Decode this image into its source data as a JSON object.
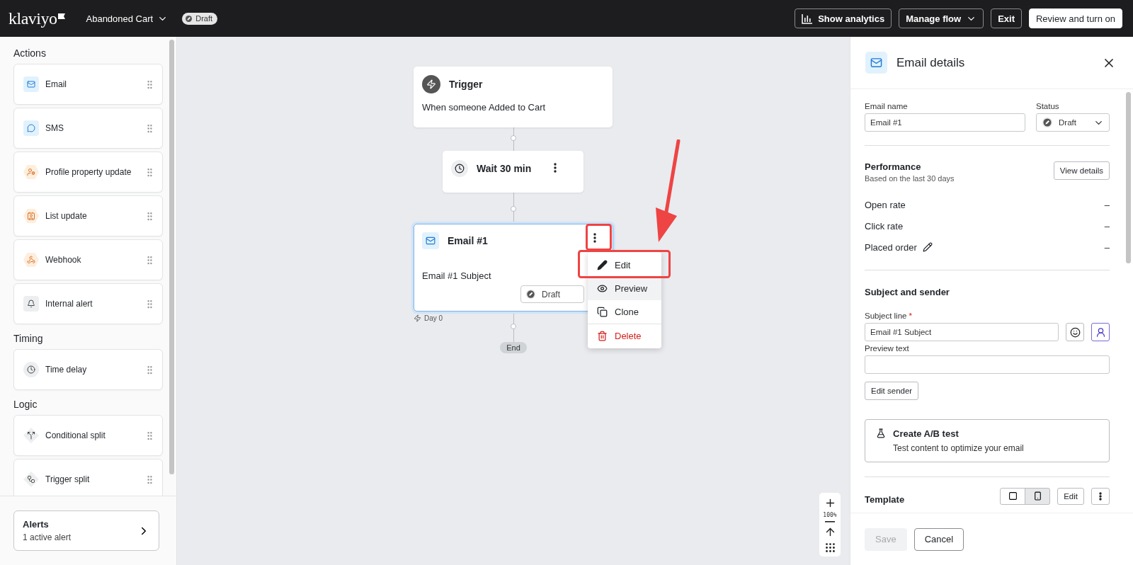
{
  "header": {
    "logo": "klaviyo",
    "flow_name": "Abandoned Cart",
    "status": "Draft",
    "buttons": [
      {
        "label": "Show analytics",
        "kind": "analytics"
      },
      {
        "label": "Manage flow",
        "kind": "dropdown"
      },
      {
        "label": "Exit",
        "kind": "plain"
      },
      {
        "label": "Review and turn on",
        "kind": "primary"
      }
    ]
  },
  "sidebar": {
    "sections": [
      {
        "title": "Actions",
        "items": [
          {
            "label": "Email",
            "kind": "email"
          },
          {
            "label": "SMS",
            "kind": "sms"
          },
          {
            "label": "Profile property update",
            "kind": "profile"
          },
          {
            "label": "List update",
            "kind": "list"
          },
          {
            "label": "Webhook",
            "kind": "webhook"
          },
          {
            "label": "Internal alert",
            "kind": "alert"
          }
        ]
      },
      {
        "title": "Timing",
        "items": [
          {
            "label": "Time delay",
            "kind": "delay"
          }
        ]
      },
      {
        "title": "Logic",
        "items": [
          {
            "label": "Conditional split",
            "kind": "conditional"
          },
          {
            "label": "Trigger split",
            "kind": "triggersplit"
          }
        ]
      }
    ],
    "alerts": {
      "title": "Alerts",
      "subtitle": "1 active alert"
    }
  },
  "canvas": {
    "nodes": [
      {
        "kind": "trigger",
        "title": "Trigger",
        "text": "When someone Added to Cart",
        "selected": false
      },
      {
        "kind": "delay",
        "title": "Wait 30 min",
        "selected": false,
        "menu_highlighted": false
      },
      {
        "kind": "email",
        "title": "Email #1",
        "text": "Email #1 Subject",
        "status": "Draft",
        "note": "Day 0",
        "selected": true,
        "menu_highlighted": true
      }
    ],
    "end_label": "End",
    "context_menu": {
      "items": [
        {
          "label": "Edit",
          "kind": "edit",
          "highlighted": true,
          "hovered": false
        },
        {
          "label": "Preview",
          "kind": "preview",
          "highlighted": false,
          "hovered": true
        },
        {
          "label": "Clone",
          "kind": "clone",
          "highlighted": false,
          "hovered": false
        },
        {
          "label": "Delete",
          "kind": "delete",
          "highlighted": false,
          "hovered": false
        }
      ]
    },
    "annotation_arrow": true,
    "zoom": "100%"
  },
  "details": {
    "title": "Email details",
    "email_name_label": "Email name",
    "email_name": "Email #1",
    "status_label": "Status",
    "status": "Draft",
    "performance": {
      "title": "Performance",
      "subtitle": "Based on the last 30 days",
      "button": "View details",
      "metrics": [
        {
          "label": "Open rate",
          "value": "–",
          "editable": false
        },
        {
          "label": "Click rate",
          "value": "–",
          "editable": false
        },
        {
          "label": "Placed order",
          "value": "–",
          "editable": true
        }
      ]
    },
    "subject": {
      "title": "Subject and sender",
      "subject_label": "Subject line",
      "required_mark": "*",
      "subject_value": "Email #1 Subject",
      "preview_label": "Preview text",
      "sender_button": "Edit sender"
    },
    "ab_test": {
      "title": "Create A/B test",
      "text": "Test content to optimize your email"
    },
    "template": {
      "title": "Template",
      "button": "Edit",
      "views": [
        {
          "kind": "desktop",
          "selected": false
        },
        {
          "kind": "mobile",
          "selected": true
        }
      ]
    },
    "footer": {
      "save": "Save",
      "save_disabled": true,
      "cancel": "Cancel"
    }
  }
}
